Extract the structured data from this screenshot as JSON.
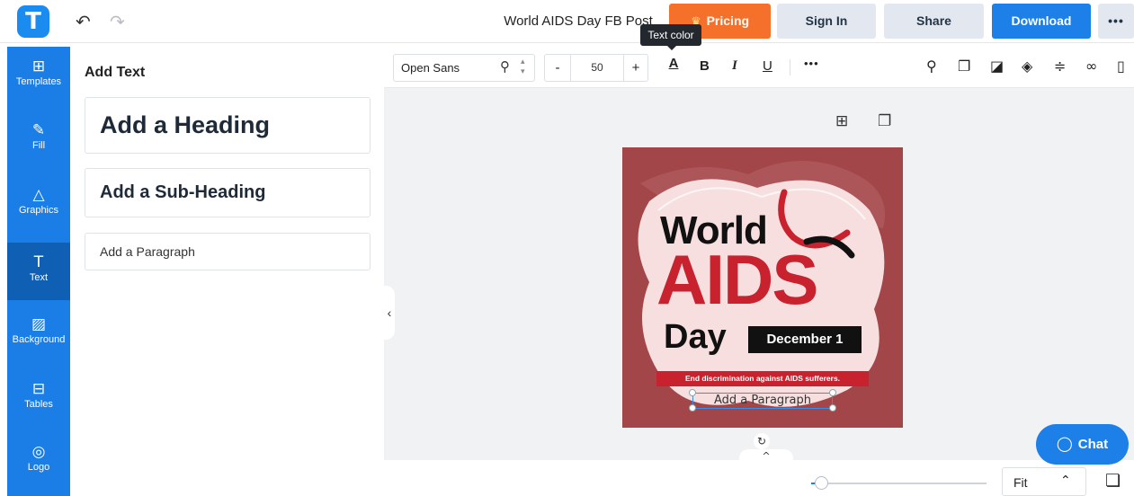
{
  "header": {
    "logo_letter": "T",
    "undo_icon": "↶",
    "redo_icon": "↷",
    "doc_title": "World AIDS Day FB Post",
    "pricing_label": "Pricing",
    "signin_label": "Sign In",
    "share_label": "Share",
    "download_label": "Download",
    "more_label": "•••",
    "pricing_color": "#f5712b",
    "download_color": "#1d7fe8"
  },
  "tooltip": {
    "text": "Text color"
  },
  "sidebar": {
    "color": "#1a7ee6",
    "items": [
      {
        "label": "Templates",
        "icon": "templates-icon"
      },
      {
        "label": "Fill",
        "icon": "pencil-icon"
      },
      {
        "label": "Graphics",
        "icon": "shapes-icon"
      },
      {
        "label": "Text",
        "icon": "text-icon"
      },
      {
        "label": "Background",
        "icon": "background-icon"
      },
      {
        "label": "Tables",
        "icon": "table-icon"
      },
      {
        "label": "Logo",
        "icon": "logo-icon"
      }
    ],
    "active": "Text"
  },
  "panel": {
    "title": "Add Text",
    "heading": "Add a Heading",
    "subheading": "Add a Sub-Heading",
    "paragraph": "Add a Paragraph"
  },
  "format": {
    "font": "Open Sans",
    "size": "50",
    "minus": "-",
    "plus": "+",
    "color_glyph": "A",
    "bold_glyph": "B",
    "italic_glyph": "I",
    "underline_glyph": "U",
    "more": "•••"
  },
  "design": {
    "line1": "World",
    "line2": "AIDS",
    "line3": "Day",
    "date": "December 1",
    "ribbon": "End discrimination against AIDS sufferers.",
    "paragraph": "Add a Paragraph",
    "bg_color": "#9b3b3f",
    "accent_color": "#c8222f"
  },
  "bottom": {
    "zoom_value": "Fit",
    "zoom_level": 0.04,
    "chevron": "^"
  },
  "chat": {
    "label": "Chat"
  }
}
